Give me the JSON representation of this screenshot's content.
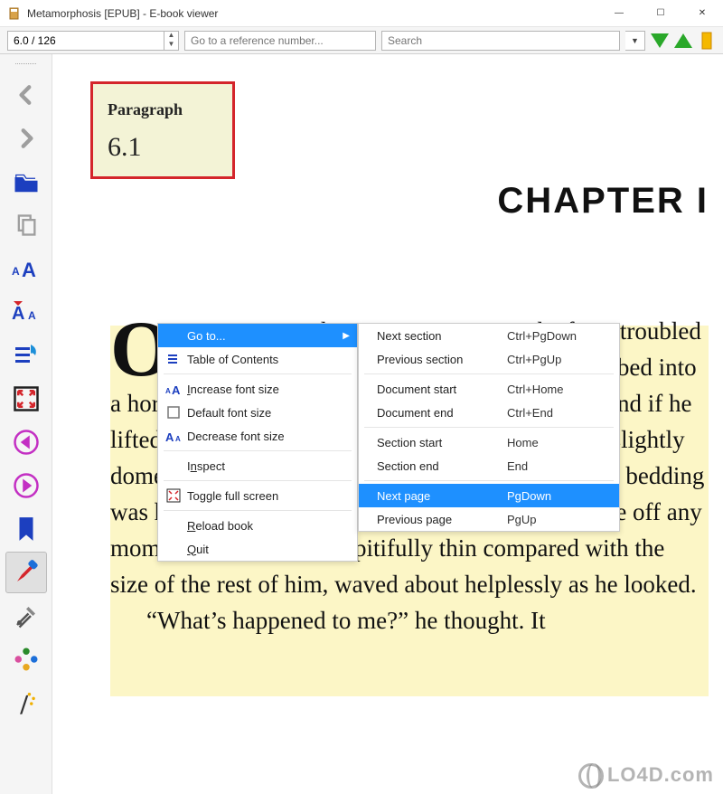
{
  "window": {
    "title": "Metamorphosis [EPUB] - E-book viewer",
    "minimize": "—",
    "maximize": "☐",
    "close": "✕"
  },
  "toolbar": {
    "page_position": "6.0 / 126",
    "ref_placeholder": "Go to a reference number...",
    "search_placeholder": "Search"
  },
  "paragraph_box": {
    "label": "Paragraph",
    "number": "6.1"
  },
  "chapter": "CHAPTER I",
  "body": {
    "dropcap": "O",
    "p1": "ne morning, when Gregor Samsa woke from troubled dreams, he found himself transformed in his bed into a horrible vermin. He lay on his armour-like back, and if he lifted his head a little he could see his brown belly, slightly domed and divided by arches into stiff sections. The bedding was hardly able to cover it and seemed ready to slide off any moment. His many legs, pitifully thin compared with the size of the rest of him, waved about helplessly as he looked.",
    "p2": "“What’s happened to me?” he thought. It"
  },
  "context_menu": {
    "items": [
      {
        "label": "Go to...",
        "selected": true,
        "submenu": true
      },
      {
        "label": "Table of Contents",
        "icon": "toc"
      },
      {
        "label": "Increase font size",
        "icon": "font-inc",
        "underline_idx": 0
      },
      {
        "label": "Default font size",
        "icon": "font-def"
      },
      {
        "label": "Decrease font size",
        "icon": "font-dec"
      },
      {
        "label": "Inspect",
        "underline_idx": 1
      },
      {
        "label": "Toggle full screen",
        "icon": "fullscreen"
      },
      {
        "label": "Reload book",
        "underline_idx": 0
      },
      {
        "label": "Quit",
        "underline_idx": 0
      }
    ],
    "separators_after": [
      1,
      4,
      5,
      6
    ]
  },
  "submenu": {
    "items": [
      {
        "label": "Next section",
        "shortcut": "Ctrl+PgDown"
      },
      {
        "label": "Previous section",
        "shortcut": "Ctrl+PgUp"
      },
      {
        "label": "Document start",
        "shortcut": "Ctrl+Home"
      },
      {
        "label": "Document end",
        "shortcut": "Ctrl+End"
      },
      {
        "label": "Section start",
        "shortcut": "Home"
      },
      {
        "label": "Section end",
        "shortcut": "End"
      },
      {
        "label": "Next page",
        "shortcut": "PgDown",
        "selected": true
      },
      {
        "label": "Previous page",
        "shortcut": "PgUp"
      }
    ],
    "separators_after": [
      1,
      3,
      5
    ]
  },
  "watermark": "LO4D.com"
}
